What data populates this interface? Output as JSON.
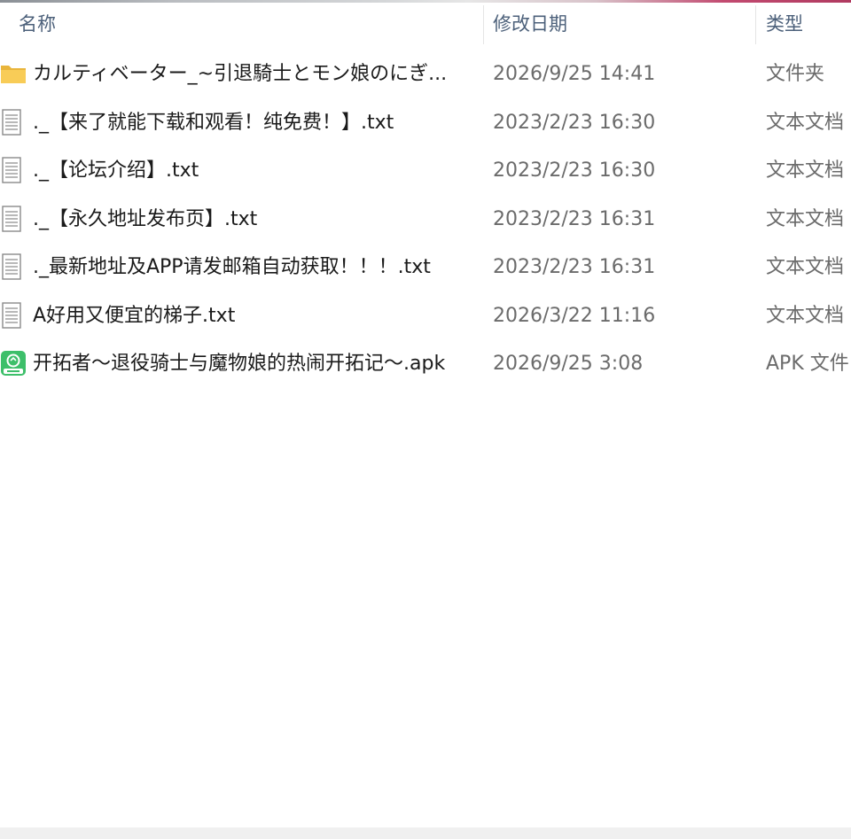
{
  "header": {
    "col_name": "名称",
    "col_date": "修改日期",
    "col_type": "类型"
  },
  "files": [
    {
      "icon": "folder-icon",
      "name": "カルティベーター_~引退騎士とモン娘のにぎ...",
      "date": "2026/9/25 14:41",
      "type": "文件夹"
    },
    {
      "icon": "text-file-icon",
      "name": "._【来了就能下载和观看！纯免费！】.txt",
      "date": "2023/2/23 16:30",
      "type": "文本文档"
    },
    {
      "icon": "text-file-icon",
      "name": "._【论坛介绍】.txt",
      "date": "2023/2/23 16:30",
      "type": "文本文档"
    },
    {
      "icon": "text-file-icon",
      "name": "._【永久地址发布页】.txt",
      "date": "2023/2/23 16:31",
      "type": "文本文档"
    },
    {
      "icon": "text-file-icon",
      "name": "._最新地址及APP请发邮箱自动获取！！！.txt",
      "date": "2023/2/23 16:31",
      "type": "文本文档"
    },
    {
      "icon": "text-file-icon",
      "name": "A好用又便宜的梯子.txt",
      "date": "2026/3/22 11:16",
      "type": "文本文档"
    },
    {
      "icon": "apk-file-icon",
      "name": "开拓者～退役骑士与魔物娘的热闹开拓记～.apk",
      "date": "2026/9/25 3:08",
      "type": "APK 文件"
    }
  ],
  "colors": {
    "header_text": "#4c607a",
    "folder": "#f5c24a",
    "apk_green": "#3dbf6a"
  }
}
